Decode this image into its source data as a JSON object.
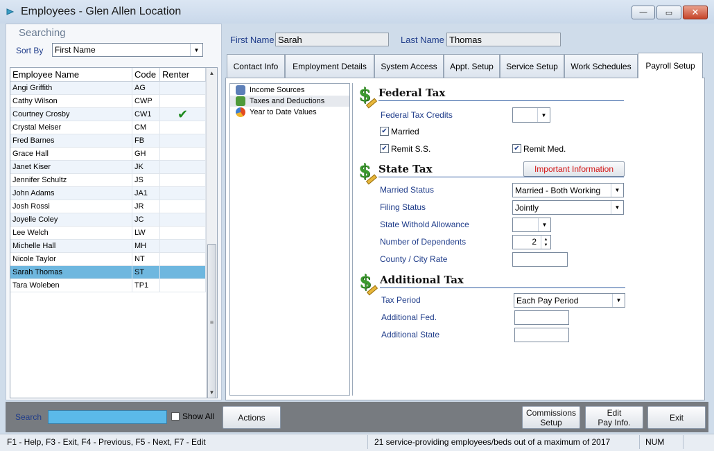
{
  "window": {
    "title": "Employees - Glen Allen Location",
    "controls": {
      "minimize": "—",
      "maximize": "▭",
      "close": "✕"
    }
  },
  "left": {
    "searching_label": "Searching",
    "sort_by_label": "Sort By",
    "sort_by_value": "First Name",
    "columns": [
      "Employee Name",
      "Code",
      "Renter"
    ],
    "rows": [
      {
        "name": "Angi Griffith",
        "code": "AG",
        "renter": ""
      },
      {
        "name": "Cathy Wilson",
        "code": "CWP",
        "renter": ""
      },
      {
        "name": "Courtney Crosby",
        "code": "CW1",
        "renter": "✔"
      },
      {
        "name": "Crystal Meiser",
        "code": "CM",
        "renter": ""
      },
      {
        "name": "Fred Barnes",
        "code": "FB",
        "renter": ""
      },
      {
        "name": "Grace Hall",
        "code": "GH",
        "renter": ""
      },
      {
        "name": "Janet Kiser",
        "code": "JK",
        "renter": ""
      },
      {
        "name": "Jennifer Schultz",
        "code": "JS",
        "renter": ""
      },
      {
        "name": "John Adams",
        "code": "JA1",
        "renter": ""
      },
      {
        "name": "Josh Rossi",
        "code": "JR",
        "renter": ""
      },
      {
        "name": "Joyelle Coley",
        "code": "JC",
        "renter": ""
      },
      {
        "name": "Lee Welch",
        "code": "LW",
        "renter": ""
      },
      {
        "name": "Michelle Hall",
        "code": "MH",
        "renter": ""
      },
      {
        "name": "Nicole Taylor",
        "code": "NT",
        "renter": ""
      },
      {
        "name": "Sarah Thomas",
        "code": "ST",
        "renter": "",
        "selected": true
      },
      {
        "name": "Tara Woleben",
        "code": "TP1",
        "renter": ""
      }
    ]
  },
  "header": {
    "first_name_label": "First Name",
    "first_name_value": "Sarah",
    "last_name_label": "Last Name",
    "last_name_value": "Thomas"
  },
  "tabs": [
    {
      "label": "Contact Info"
    },
    {
      "label": "Employment Details"
    },
    {
      "label": "System Access"
    },
    {
      "label": "Appt. Setup"
    },
    {
      "label": "Service Setup"
    },
    {
      "label": "Work Schedules"
    },
    {
      "label": "Payroll Setup",
      "active": true
    }
  ],
  "tree": {
    "items": [
      {
        "label": "Income Sources",
        "icon": "pencil-icon"
      },
      {
        "label": "Taxes and Deductions",
        "icon": "dollar-icon",
        "selected": true
      },
      {
        "label": "Year to Date Values",
        "icon": "pie-chart-icon"
      }
    ]
  },
  "federal": {
    "title": "Federal Tax",
    "credits_label": "Federal Tax Credits",
    "credits_value": "",
    "married_label": "Married",
    "married_checked": true,
    "remit_ss_label": "Remit S.S.",
    "remit_ss_checked": true,
    "remit_med_label": "Remit Med.",
    "remit_med_checked": true
  },
  "state": {
    "title": "State Tax",
    "important_button": "Important Information",
    "married_status_label": "Married Status",
    "married_status_value": "Married - Both Working",
    "filing_status_label": "Filing Status",
    "filing_status_value": "Jointly",
    "withold_label": "State Withold Allowance",
    "withold_value": "",
    "dependents_label": "Number of Dependents",
    "dependents_value": "2",
    "county_label": "County / City Rate",
    "county_value": ""
  },
  "additional": {
    "title": "Additional Tax",
    "tax_period_label": "Tax Period",
    "tax_period_value": "Each Pay Period",
    "add_fed_label": "Additional Fed.",
    "add_fed_value": "",
    "add_state_label": "Additional State",
    "add_state_value": ""
  },
  "bottom": {
    "search_label": "Search",
    "search_value": "",
    "show_all_label": "Show All",
    "actions_button": "Actions",
    "commissions_button": "Commissions\nSetup",
    "edit_pay_button": "Edit\nPay Info.",
    "exit_button": "Exit"
  },
  "status": {
    "help_text": "F1 - Help, F3 - Exit, F4 - Previous, F5 - Next, F7 - Edit",
    "count_text": "21 service-providing employees/beds out of a maximum of 2017",
    "num_text": "NUM"
  },
  "colors": {
    "accent_blue": "#1f3c8a",
    "selected_row": "#6eb7df",
    "search_field": "#5bb9e9",
    "important_red": "#d41616"
  }
}
